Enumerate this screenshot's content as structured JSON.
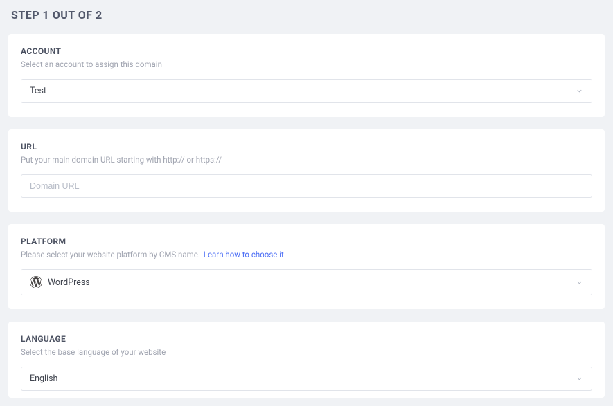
{
  "stepTitle": "STEP 1 OUT OF 2",
  "account": {
    "label": "ACCOUNT",
    "desc": "Select an account to assign this domain",
    "value": "Test"
  },
  "url": {
    "label": "URL",
    "desc": "Put your main domain URL starting with http:// or https://",
    "placeholder": "Domain URL",
    "value": ""
  },
  "platform": {
    "label": "PLATFORM",
    "desc": "Please select your website platform by CMS name.",
    "link": "Learn how to choose it",
    "value": "WordPress",
    "icon": "wordpress-icon"
  },
  "language": {
    "label": "LANGUAGE",
    "desc": "Select the base language of your website",
    "value": "English"
  }
}
